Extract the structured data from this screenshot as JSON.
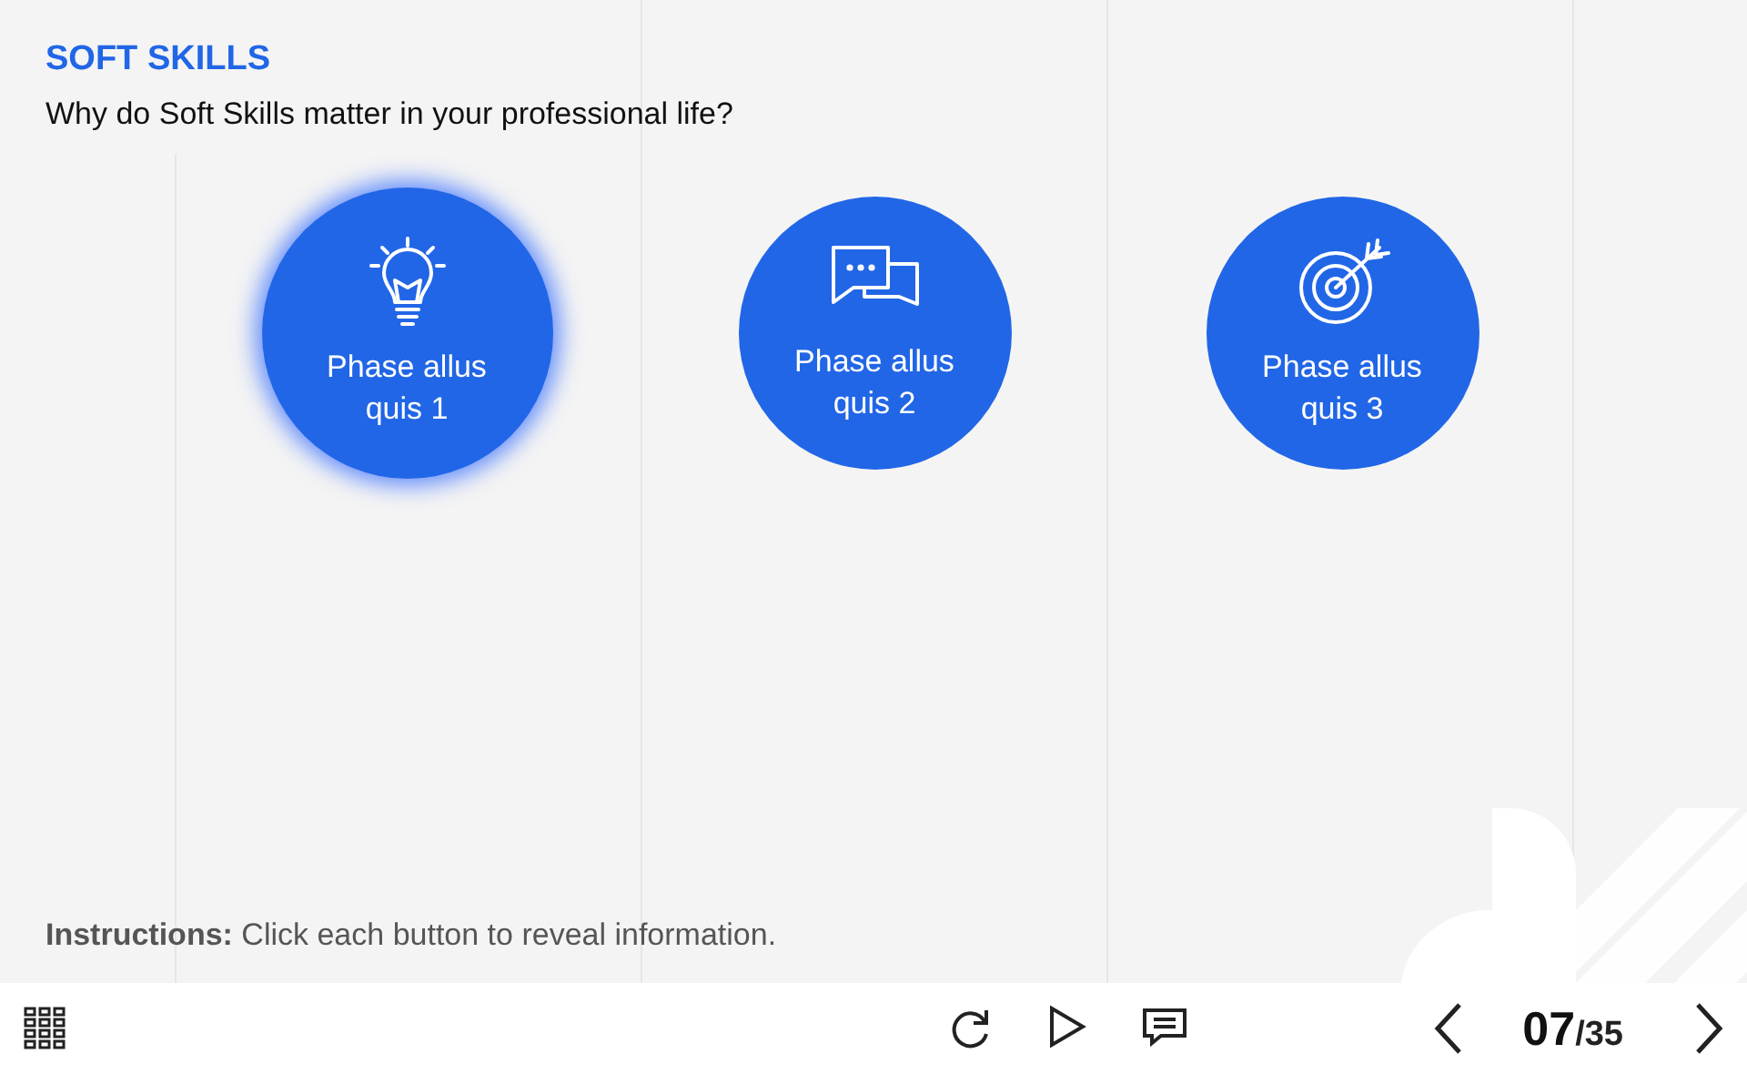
{
  "title": "SOFT SKILLS",
  "question": "Why do Soft Skills matter in your professional life?",
  "buttons": [
    {
      "label": "Phase allus quis 1",
      "selected": true
    },
    {
      "label": "Phase allus quis 2",
      "selected": false
    },
    {
      "label": "Phase allus quis 3",
      "selected": false
    }
  ],
  "instructions": "**Instructions:** Click each button to reveal information.",
  "pager": {
    "current": "07",
    "total": "/35"
  }
}
